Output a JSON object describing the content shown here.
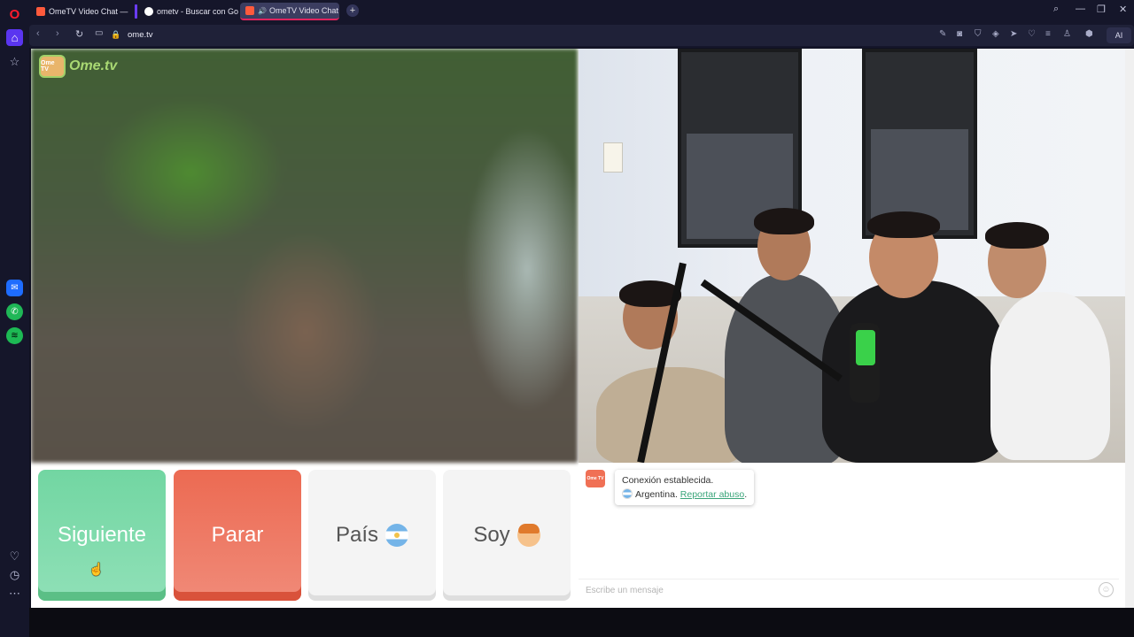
{
  "browser": {
    "tabs": [
      {
        "title": "OmeTV Video Chat — Om"
      },
      {
        "title": "ometv - Buscar con Goog"
      },
      {
        "title": "OmeTV Video Chat —",
        "active": true,
        "audio": true
      }
    ],
    "url": "ome.tv",
    "ai_label": "AI"
  },
  "rail": {
    "icons": [
      "opera-icon",
      "home-icon",
      "star-icon",
      "messenger-icon",
      "whatsapp-icon",
      "spotify-icon",
      "heart-icon",
      "clock-icon",
      "more-icon"
    ]
  },
  "page": {
    "logo_text": "Ome.tv",
    "logo_badge": "Ome TV",
    "buttons": {
      "next": "Siguiente",
      "stop": "Parar",
      "country": "País",
      "gender": "Soy"
    },
    "country_flag": "argentina-flag-icon",
    "chat": {
      "status": "Conexión establecida.",
      "country": "Argentina.",
      "report_link": "Reportar abuso",
      "report_suffix": ".",
      "input_placeholder": "Escribe un mensaje"
    }
  },
  "colors": {
    "next": "#72d6a2",
    "stop": "#ec6a52",
    "accent": "#3aa57a"
  }
}
